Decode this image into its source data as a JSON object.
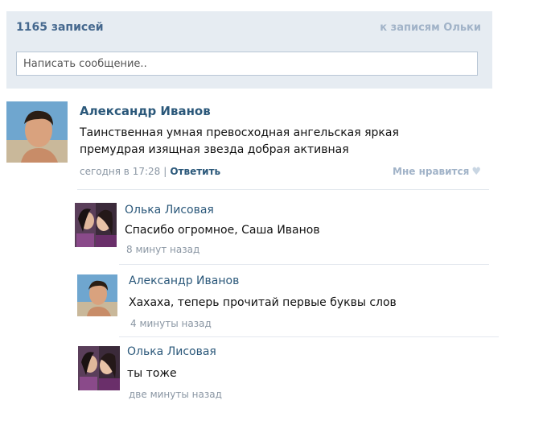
{
  "header": {
    "count": "1165 записей",
    "to_posts_link": "к записям Ольки",
    "message_placeholder": "Написать сообщение.."
  },
  "post": {
    "author": "Александр Иванов",
    "text_line1": "Таинственная умная превосходная ангельская яркая",
    "text_line2": "премудрая изящная звезда добрая активная",
    "time": "сегодня в 17:28",
    "separator": "|",
    "reply_label": "Ответить",
    "like_label": "Мне нравится",
    "like_icon": "♥"
  },
  "comments": [
    {
      "author": "Олька Лисовая",
      "text": "Спасибо огромное, Саша Иванов",
      "time": "8 минут назад"
    },
    {
      "author": "Александр Иванов",
      "text": "Хахаха, теперь прочитай первые буквы слов",
      "time": "4 минуты назад"
    },
    {
      "author": "Олька Лисовая",
      "text": "ты тоже",
      "time": "две минуты назад"
    }
  ],
  "colors": {
    "header_bg": "#e6ecf2",
    "link": "#2b587a",
    "muted": "#8a96a3"
  }
}
